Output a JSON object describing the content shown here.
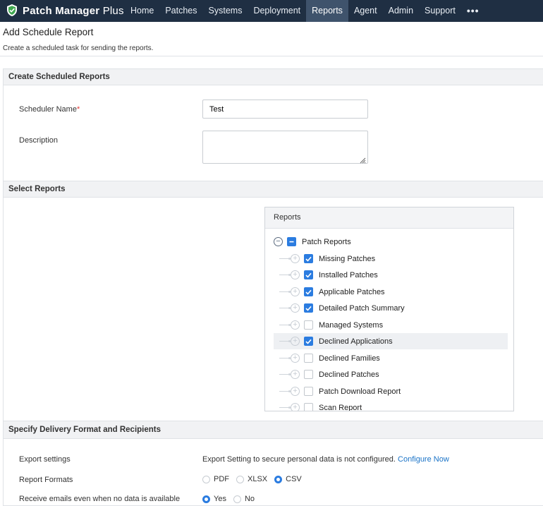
{
  "app": {
    "name": "Patch Manager Plus",
    "name_main": "Patch Manager",
    "name_suffix": "Plus"
  },
  "nav": {
    "items": [
      {
        "label": "Home"
      },
      {
        "label": "Patches"
      },
      {
        "label": "Systems"
      },
      {
        "label": "Deployment"
      },
      {
        "label": "Reports",
        "active": true
      },
      {
        "label": "Agent"
      },
      {
        "label": "Admin"
      },
      {
        "label": "Support"
      },
      {
        "label": "•••"
      }
    ]
  },
  "page": {
    "title": "Add Schedule Report",
    "subtitle": "Create a scheduled task for sending the reports."
  },
  "create": {
    "header": "Create Scheduled Reports",
    "scheduler_name_label": "Scheduler Name",
    "required_mark": "*",
    "scheduler_name_value": "Test",
    "description_label": "Description",
    "description_value": ""
  },
  "select": {
    "header": "Select Reports",
    "box_header": "Reports",
    "root": {
      "label": "Patch Reports",
      "state": "partial"
    },
    "items": [
      {
        "label": "Missing Patches",
        "checked": true
      },
      {
        "label": "Installed Patches",
        "checked": true
      },
      {
        "label": "Applicable Patches",
        "checked": true
      },
      {
        "label": "Detailed Patch Summary",
        "checked": true
      },
      {
        "label": "Managed Systems",
        "checked": false
      },
      {
        "label": "Declined Applications",
        "checked": true,
        "highlighted": true
      },
      {
        "label": "Declined Families",
        "checked": false
      },
      {
        "label": "Declined Patches",
        "checked": false
      },
      {
        "label": "Patch Download Report",
        "checked": false
      },
      {
        "label": "Scan Report",
        "checked": false
      }
    ]
  },
  "delivery": {
    "header": "Specify Delivery Format and Recipients",
    "export_label": "Export settings",
    "export_text": "Export Setting to secure personal data is not configured.",
    "export_link": "Configure Now",
    "formats_label": "Report Formats",
    "formats": [
      {
        "label": "PDF",
        "selected": false
      },
      {
        "label": "XLSX",
        "selected": false
      },
      {
        "label": "CSV",
        "selected": true
      }
    ],
    "empty_label": "Receive emails even when no data is available",
    "empty_options": [
      {
        "label": "Yes",
        "selected": true
      },
      {
        "label": "No",
        "selected": false
      }
    ]
  },
  "colors": {
    "topbar": "#1f2f43",
    "active_nav": "#3f536c",
    "accent": "#2b7ce0",
    "link": "#1a73c7",
    "required": "#e53935"
  },
  "icons": {
    "logo": "shield-logo-icon",
    "tree_collapse": "minus-circle-icon",
    "tree_expand": "plus-circle-icon",
    "check": "check-icon",
    "resize": "resize-grip-icon"
  }
}
